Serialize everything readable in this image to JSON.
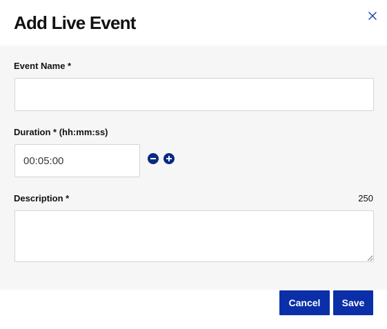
{
  "dialog": {
    "title": "Add Live Event",
    "close_icon": "close-icon"
  },
  "form": {
    "event_name": {
      "label": "Event Name *",
      "value": "",
      "placeholder": ""
    },
    "duration": {
      "label": "Duration * (hh:mm:ss)",
      "value": "00:05:00",
      "decrement_icon": "minus-circle-icon",
      "increment_icon": "plus-circle-icon"
    },
    "description": {
      "label": "Description *",
      "char_count": "250",
      "value": "",
      "placeholder": ""
    }
  },
  "footer": {
    "cancel_label": "Cancel",
    "save_label": "Save"
  },
  "colors": {
    "accent": "#0a2fa8",
    "icon_dark": "#0a2a82",
    "body_bg": "#f6f6f6"
  }
}
